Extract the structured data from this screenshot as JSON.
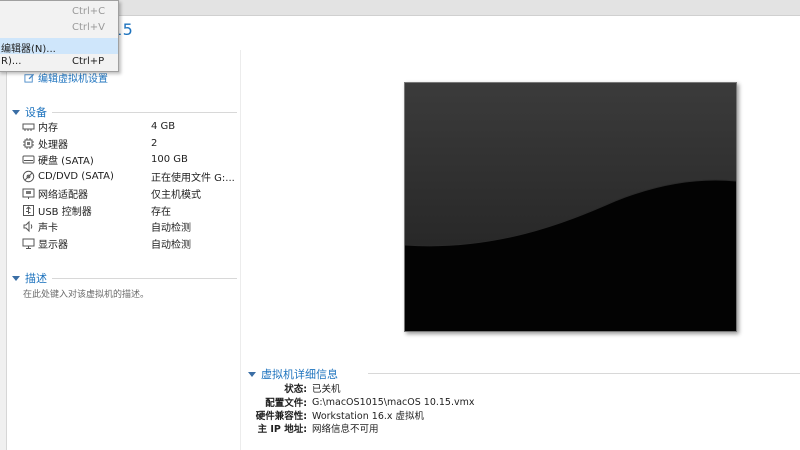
{
  "window": {
    "title_fragment": "15"
  },
  "context_menu": {
    "items": [
      {
        "label": "",
        "shortcut": "Ctrl+C",
        "disabled": true
      },
      {
        "label": "",
        "shortcut": "Ctrl+V",
        "disabled": true
      },
      {
        "label": "编辑器(N)...",
        "shortcut": "",
        "highlighted": true
      },
      {
        "label": "R)...",
        "shortcut": "Ctrl+P"
      }
    ]
  },
  "actions": {
    "edit_settings": "编辑虚拟机设置"
  },
  "devices": {
    "header": "设备",
    "items": [
      {
        "name": "内存",
        "value": "4 GB",
        "icon": "memory-icon"
      },
      {
        "name": "处理器",
        "value": "2",
        "icon": "cpu-icon"
      },
      {
        "name": "硬盘 (SATA)",
        "value": "100 GB",
        "icon": "hard-disk-icon"
      },
      {
        "name": "CD/DVD (SATA)",
        "value": "正在使用文件 G:...",
        "icon": "cd-dvd-icon"
      },
      {
        "name": "网络适配器",
        "value": "仅主机模式",
        "icon": "network-adapter-icon"
      },
      {
        "name": "USB 控制器",
        "value": "存在",
        "icon": "usb-icon"
      },
      {
        "name": "声卡",
        "value": "自动检测",
        "icon": "sound-card-icon"
      },
      {
        "name": "显示器",
        "value": "自动检测",
        "icon": "monitor-icon"
      }
    ]
  },
  "description": {
    "header": "描述",
    "placeholder": "在此处键入对该虚拟机的描述。"
  },
  "details": {
    "header": "虚拟机详细信息",
    "rows": [
      {
        "label": "状态:",
        "value": "已关机"
      },
      {
        "label": "配置文件:",
        "value": "G:\\macOS1015\\macOS 10.15.vmx"
      },
      {
        "label": "硬件兼容性:",
        "value": "Workstation 16.x 虚拟机"
      },
      {
        "label": "主 IP 地址:",
        "value": "网络信息不可用"
      }
    ]
  },
  "colors": {
    "accent": "#1e73be",
    "menu_highlight": "#cfe6fb"
  }
}
